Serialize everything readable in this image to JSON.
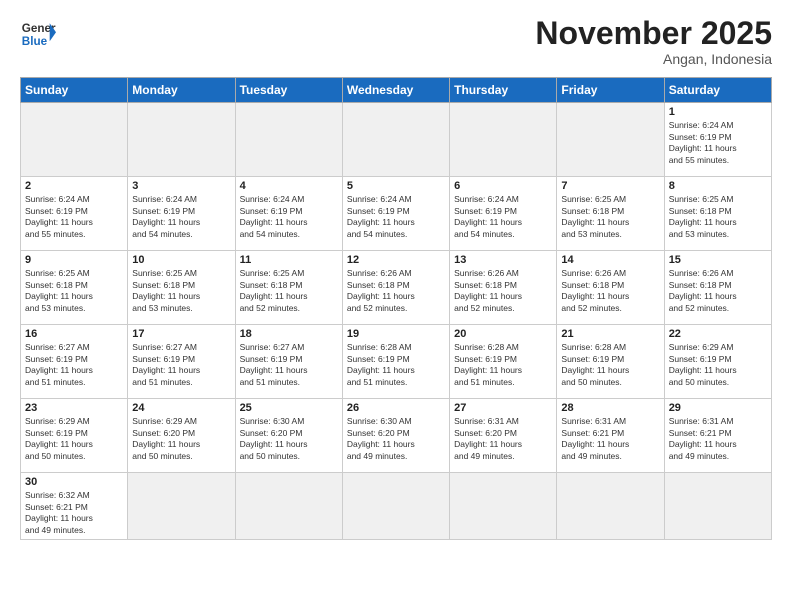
{
  "header": {
    "logo_general": "General",
    "logo_blue": "Blue",
    "month_title": "November 2025",
    "subtitle": "Angan, Indonesia"
  },
  "weekdays": [
    "Sunday",
    "Monday",
    "Tuesday",
    "Wednesday",
    "Thursday",
    "Friday",
    "Saturday"
  ],
  "days": [
    {
      "num": "",
      "empty": true
    },
    {
      "num": "",
      "empty": true
    },
    {
      "num": "",
      "empty": true
    },
    {
      "num": "",
      "empty": true
    },
    {
      "num": "",
      "empty": true
    },
    {
      "num": "",
      "empty": true
    },
    {
      "num": "1",
      "sunrise": "6:24 AM",
      "sunset": "6:19 PM",
      "hours": "11",
      "mins": "55"
    },
    {
      "num": "2",
      "sunrise": "6:24 AM",
      "sunset": "6:19 PM",
      "hours": "11",
      "mins": "55"
    },
    {
      "num": "3",
      "sunrise": "6:24 AM",
      "sunset": "6:19 PM",
      "hours": "11",
      "mins": "54"
    },
    {
      "num": "4",
      "sunrise": "6:24 AM",
      "sunset": "6:19 PM",
      "hours": "11",
      "mins": "54"
    },
    {
      "num": "5",
      "sunrise": "6:24 AM",
      "sunset": "6:19 PM",
      "hours": "11",
      "mins": "54"
    },
    {
      "num": "6",
      "sunrise": "6:24 AM",
      "sunset": "6:19 PM",
      "hours": "11",
      "mins": "54"
    },
    {
      "num": "7",
      "sunrise": "6:25 AM",
      "sunset": "6:18 PM",
      "hours": "11",
      "mins": "53"
    },
    {
      "num": "8",
      "sunrise": "6:25 AM",
      "sunset": "6:18 PM",
      "hours": "11",
      "mins": "53"
    },
    {
      "num": "9",
      "sunrise": "6:25 AM",
      "sunset": "6:18 PM",
      "hours": "11",
      "mins": "53"
    },
    {
      "num": "10",
      "sunrise": "6:25 AM",
      "sunset": "6:18 PM",
      "hours": "11",
      "mins": "53"
    },
    {
      "num": "11",
      "sunrise": "6:25 AM",
      "sunset": "6:18 PM",
      "hours": "11",
      "mins": "52"
    },
    {
      "num": "12",
      "sunrise": "6:26 AM",
      "sunset": "6:18 PM",
      "hours": "11",
      "mins": "52"
    },
    {
      "num": "13",
      "sunrise": "6:26 AM",
      "sunset": "6:18 PM",
      "hours": "11",
      "mins": "52"
    },
    {
      "num": "14",
      "sunrise": "6:26 AM",
      "sunset": "6:18 PM",
      "hours": "11",
      "mins": "52"
    },
    {
      "num": "15",
      "sunrise": "6:26 AM",
      "sunset": "6:18 PM",
      "hours": "11",
      "mins": "52"
    },
    {
      "num": "16",
      "sunrise": "6:27 AM",
      "sunset": "6:19 PM",
      "hours": "11",
      "mins": "51"
    },
    {
      "num": "17",
      "sunrise": "6:27 AM",
      "sunset": "6:19 PM",
      "hours": "11",
      "mins": "51"
    },
    {
      "num": "18",
      "sunrise": "6:27 AM",
      "sunset": "6:19 PM",
      "hours": "11",
      "mins": "51"
    },
    {
      "num": "19",
      "sunrise": "6:28 AM",
      "sunset": "6:19 PM",
      "hours": "11",
      "mins": "51"
    },
    {
      "num": "20",
      "sunrise": "6:28 AM",
      "sunset": "6:19 PM",
      "hours": "11",
      "mins": "51"
    },
    {
      "num": "21",
      "sunrise": "6:28 AM",
      "sunset": "6:19 PM",
      "hours": "11",
      "mins": "50"
    },
    {
      "num": "22",
      "sunrise": "6:29 AM",
      "sunset": "6:19 PM",
      "hours": "11",
      "mins": "50"
    },
    {
      "num": "23",
      "sunrise": "6:29 AM",
      "sunset": "6:19 PM",
      "hours": "11",
      "mins": "50"
    },
    {
      "num": "24",
      "sunrise": "6:29 AM",
      "sunset": "6:20 PM",
      "hours": "11",
      "mins": "50"
    },
    {
      "num": "25",
      "sunrise": "6:30 AM",
      "sunset": "6:20 PM",
      "hours": "11",
      "mins": "50"
    },
    {
      "num": "26",
      "sunrise": "6:30 AM",
      "sunset": "6:20 PM",
      "hours": "11",
      "mins": "49"
    },
    {
      "num": "27",
      "sunrise": "6:31 AM",
      "sunset": "6:20 PM",
      "hours": "11",
      "mins": "49"
    },
    {
      "num": "28",
      "sunrise": "6:31 AM",
      "sunset": "6:21 PM",
      "hours": "11",
      "mins": "49"
    },
    {
      "num": "29",
      "sunrise": "6:31 AM",
      "sunset": "6:21 PM",
      "hours": "11",
      "mins": "49"
    },
    {
      "num": "30",
      "sunrise": "6:32 AM",
      "sunset": "6:21 PM",
      "hours": "11",
      "mins": "49"
    }
  ]
}
